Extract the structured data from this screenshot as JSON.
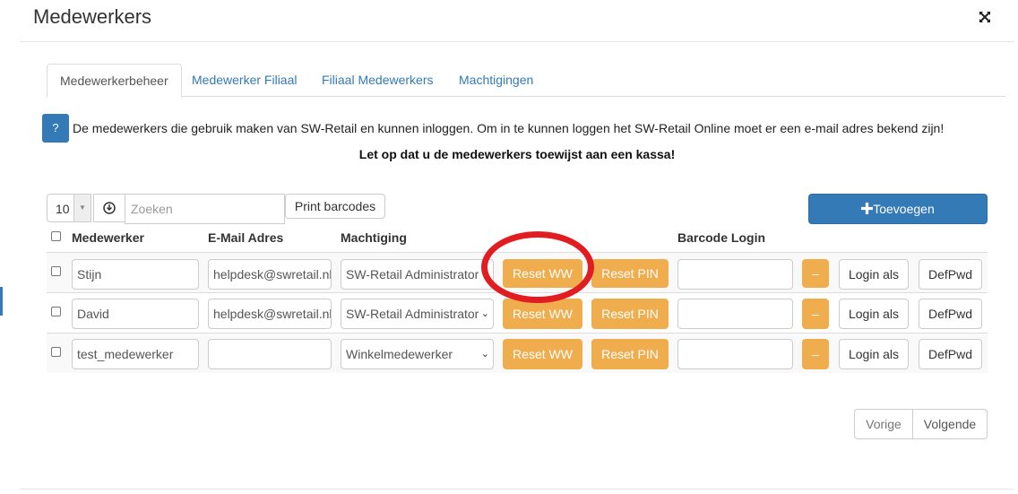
{
  "modal": {
    "title": "Medewerkers"
  },
  "tabs": [
    {
      "label": "Medewerkerbeheer",
      "active": true
    },
    {
      "label": "Medewerker Filiaal",
      "active": false
    },
    {
      "label": "Filiaal Medewerkers",
      "active": false
    },
    {
      "label": "Machtigingen",
      "active": false
    }
  ],
  "help": {
    "icon_label": "?",
    "info_text": "De medewerkers die gebruik maken van SW-Retail en kunnen inloggen. Om in te kunnen loggen het SW-Retail Online moet er een e-mail adres bekend zijn!",
    "warning_text": "Let op dat u de medewerkers toewijst aan een kassa!"
  },
  "toolbar": {
    "page_size": "10",
    "search_placeholder": "Zoeken",
    "print_label": "Print barcodes",
    "add_label": "Toevoegen",
    "add_icon": "plus-icon"
  },
  "table": {
    "headers": {
      "medewerker": "Medewerker",
      "email": "E-Mail Adres",
      "machtiging": "Machtiging",
      "barcode": "Barcode Login"
    },
    "rows": [
      {
        "name": "Stijn",
        "email": "helpdesk@swretail.nl",
        "machtiging": "SW-Retail Administrator",
        "reset_ww": "Reset WW",
        "reset_pin": "Reset PIN",
        "barcode": "",
        "dash": "–",
        "login": "Login als",
        "defpwd": "DefPwd"
      },
      {
        "name": "David",
        "email": "helpdesk@swretail.nl",
        "machtiging": "SW-Retail Administrator",
        "reset_ww": "Reset WW",
        "reset_pin": "Reset PIN",
        "barcode": "",
        "dash": "–",
        "login": "Login als",
        "defpwd": "DefPwd"
      },
      {
        "name": "test_medewerker",
        "email": "",
        "machtiging": "Winkelmedewerker",
        "reset_ww": "Reset WW",
        "reset_pin": "Reset PIN",
        "barcode": "",
        "dash": "–",
        "login": "Login als",
        "defpwd": "DefPwd"
      }
    ]
  },
  "pager": {
    "prev": "Vorige",
    "next": "Volgende"
  },
  "colors": {
    "primary": "#337ab7",
    "warning": "#f0ad4e",
    "highlight_circle": "#e11d21"
  }
}
